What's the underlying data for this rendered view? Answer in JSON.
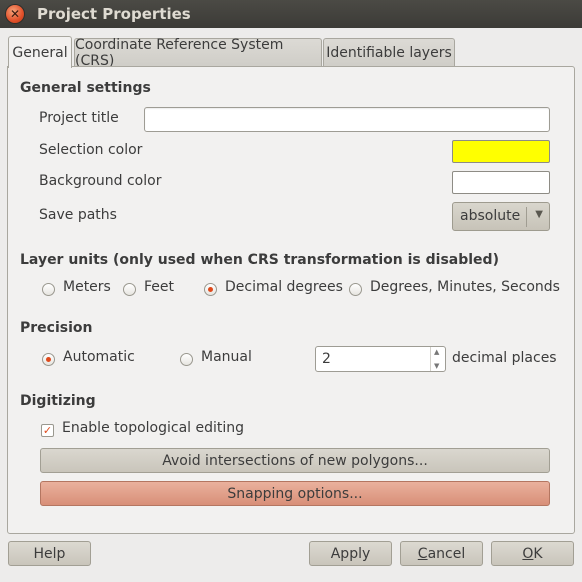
{
  "window": {
    "title": "Project Properties"
  },
  "tabs": [
    {
      "label": "General"
    },
    {
      "label": "Coordinate Reference System (CRS)"
    },
    {
      "label": "Identifiable layers"
    }
  ],
  "general": {
    "heading": "General settings",
    "project_title_label": "Project title",
    "project_title_value": "",
    "selection_color_label": "Selection color",
    "selection_color": "#ffff00",
    "background_color_label": "Background color",
    "background_color": "#ffffff",
    "save_paths_label": "Save paths",
    "save_paths_value": "absolute"
  },
  "layer_units": {
    "heading": "Layer units (only used when CRS transformation is disabled)",
    "options": [
      {
        "label": "Meters",
        "checked": false
      },
      {
        "label": "Feet",
        "checked": false
      },
      {
        "label": "Decimal degrees",
        "checked": true
      },
      {
        "label": "Degrees, Minutes, Seconds",
        "checked": false
      }
    ]
  },
  "precision": {
    "heading": "Precision",
    "automatic_label": "Automatic",
    "manual_label": "Manual",
    "selected": "Automatic",
    "decimal_value": "2",
    "decimal_suffix": "decimal places"
  },
  "digitizing": {
    "heading": "Digitizing",
    "topological_label": "Enable topological editing",
    "topological_checked": true,
    "avoid_button": "Avoid intersections of new polygons...",
    "snapping_button": "Snapping options..."
  },
  "buttons": {
    "help": "Help",
    "apply": "Apply",
    "cancel_first": "C",
    "cancel_rest": "ancel",
    "ok_first": "O",
    "ok_rest": "K"
  },
  "colors": {
    "accent": "#df4a1c",
    "titlebar": "#3c3b37"
  }
}
